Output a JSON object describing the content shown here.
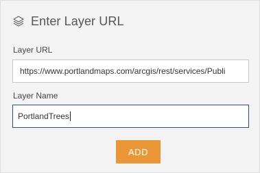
{
  "header": {
    "icon": "layers-icon",
    "title": "Enter Layer URL"
  },
  "form": {
    "layer_url_label": "Layer URL",
    "layer_url_value": "https://www.portlandmaps.com/arcgis/rest/services/Publi",
    "layer_name_label": "Layer Name",
    "layer_name_value": "PortlandTrees",
    "add_button_label": "ADD"
  },
  "colors": {
    "panel_bg": "#f3f3f3",
    "accent_button": "#ea9637",
    "focus_border": "#2b4e83"
  }
}
